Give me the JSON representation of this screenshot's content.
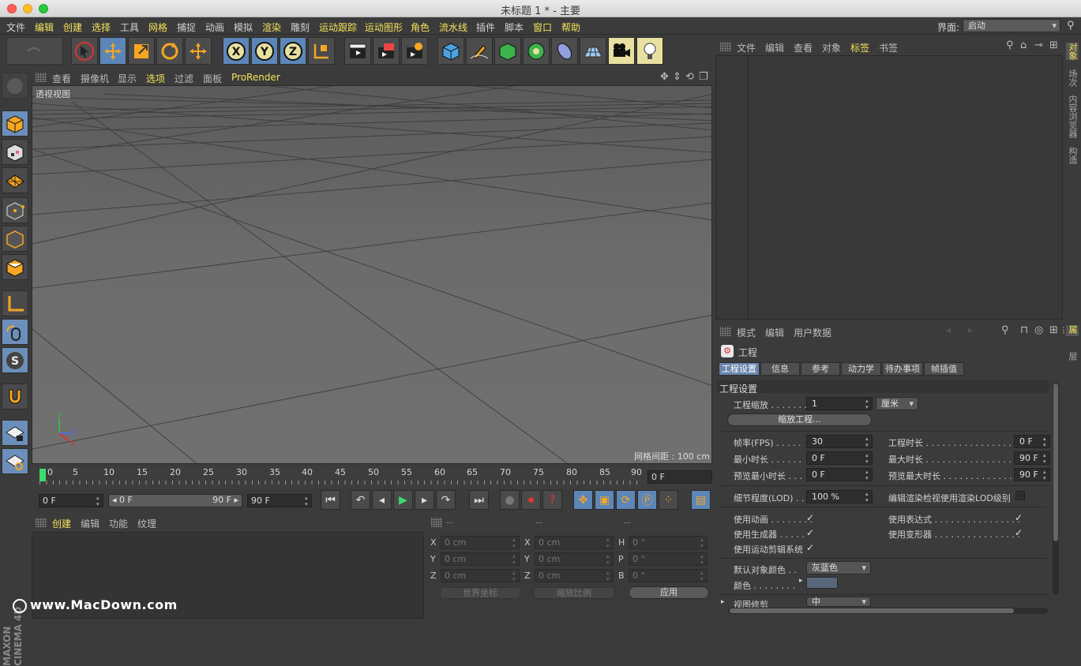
{
  "window": {
    "title": "未标题 1 * - 主要"
  },
  "menu": {
    "items": [
      "文件",
      "编辑",
      "创建",
      "选择",
      "工具",
      "网格",
      "捕捉",
      "动画",
      "模拟",
      "渲染",
      "雕刻",
      "运动跟踪",
      "运动图形",
      "角色",
      "流水线",
      "插件",
      "脚本",
      "窗口",
      "帮助"
    ],
    "layout_label": "界面:",
    "layout_value": "启动"
  },
  "viewport": {
    "menu": [
      "查看",
      "摄像机",
      "显示",
      "选项",
      "过滤",
      "面板",
      "ProRender"
    ],
    "name": "透视视图",
    "grid_spacing": "网格间距 : 100 cm",
    "axis": {
      "x": "X",
      "y": "Y",
      "z": "Z"
    }
  },
  "timeline": {
    "ticks": [
      "0",
      "5",
      "10",
      "15",
      "20",
      "25",
      "30",
      "35",
      "40",
      "45",
      "50",
      "55",
      "60",
      "65",
      "70",
      "75",
      "80",
      "85",
      "90"
    ],
    "current_frame": "0 F",
    "start": "0 F",
    "range_start": "0 F",
    "range_end": "90 F",
    "end": "90 F"
  },
  "material_manager": {
    "menu": [
      "创建",
      "编辑",
      "功能",
      "纹理"
    ]
  },
  "coords": {
    "headers": [
      "--",
      "--",
      "--"
    ],
    "rows": [
      {
        "a": "X",
        "av": "0 cm",
        "b": "X",
        "bv": "0 cm",
        "c": "H",
        "cv": "0 °"
      },
      {
        "a": "Y",
        "av": "0 cm",
        "b": "Y",
        "bv": "0 cm",
        "c": "P",
        "cv": "0 °"
      },
      {
        "a": "Z",
        "av": "0 cm",
        "b": "Z",
        "bv": "0 cm",
        "c": "B",
        "cv": "0 °"
      }
    ],
    "world": "世界坐标",
    "scale": "缩放比例",
    "apply": "应用"
  },
  "object_manager": {
    "menu": [
      "文件",
      "编辑",
      "查看",
      "对象",
      "标签",
      "书签"
    ]
  },
  "right_tabs": {
    "top": [
      "对象",
      "场次",
      "内容浏览器",
      "构造"
    ],
    "bottom": [
      "属性",
      "层"
    ]
  },
  "attributes": {
    "menu": [
      "模式",
      "编辑",
      "用户数据"
    ],
    "object_name": "工程",
    "tabs": [
      "工程设置",
      "信息",
      "参考",
      "动力学",
      "待办事项",
      "帧插值"
    ],
    "section": "工程设置",
    "project_scale_label": "工程缩放 . . . . . . .",
    "project_scale_value": "1",
    "project_scale_unit": "厘米",
    "scale_button": "缩放工程...",
    "fps_label": "帧率(FPS) . . . . .",
    "fps_value": "30",
    "project_time_label": "工程时长 . . . . . . . . . . . . . . . . .",
    "project_time_value": "0 F",
    "min_time_label": "最小时长 . . . . . .",
    "min_time_value": "0 F",
    "max_time_label": "最大时长 . . . . . . . . . . . . . . . . .",
    "max_time_value": "90 F",
    "preview_min_label": "预览最小时长 . . .",
    "preview_min_value": "0 F",
    "preview_max_label": "预览最大时长 . . . . . . . . . . . . .",
    "preview_max_value": "90 F",
    "lod_label": "细节程度(LOD) . .",
    "lod_value": "100 %",
    "lod_render_label": "编辑渲染检视使用渲染LOD级别",
    "use_anim_label": "使用动画 . . . . . . . .",
    "use_expr_label": "使用表达式 . . . . . . . . . . . . . . . .",
    "use_gen_label": "使用生成器 . . . . .",
    "use_deform_label": "使用变形器 . . . . . . . . . . . . . . . .",
    "use_motion_label": "使用运动剪辑系统",
    "default_color_label": "默认对象颜色 . .",
    "default_color_value": "灰蓝色",
    "color_label": "颜色 . . . . . . . .",
    "view_clip_label": "视图修剪",
    "view_clip_value": "中"
  },
  "watermark": "www.MacDown.com",
  "logo_text": "MAXON CINEMA 4D",
  "colors": {
    "accent_yellow": "#f4e25a",
    "selected_blue": "#6a86ad",
    "bg": "#3b3b3b"
  }
}
